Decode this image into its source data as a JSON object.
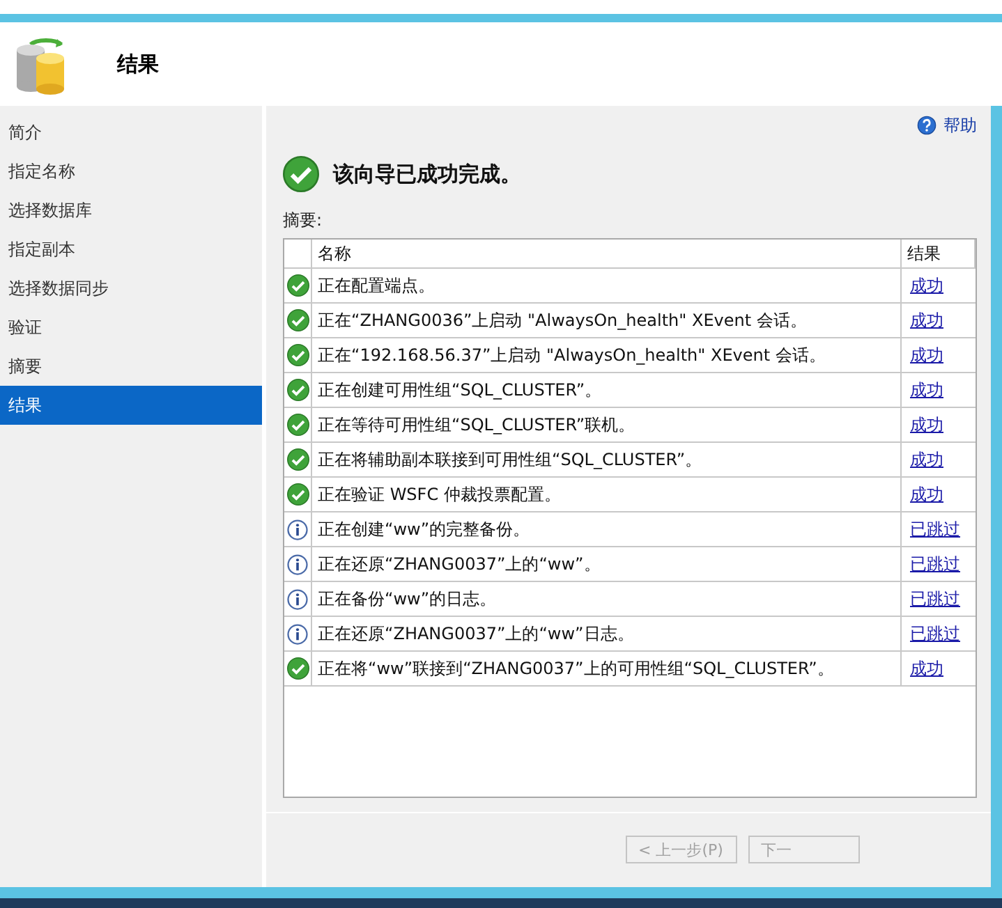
{
  "header": {
    "title": "结果"
  },
  "sidebar": {
    "items": [
      {
        "label": "简介",
        "selected": false
      },
      {
        "label": "指定名称",
        "selected": false
      },
      {
        "label": "选择数据库",
        "selected": false
      },
      {
        "label": "指定副本",
        "selected": false
      },
      {
        "label": "选择数据同步",
        "selected": false
      },
      {
        "label": "验证",
        "selected": false
      },
      {
        "label": "摘要",
        "selected": false
      },
      {
        "label": "结果",
        "selected": true
      }
    ]
  },
  "help_link": "帮助",
  "status_message": "该向导已成功完成。",
  "summary_label": "摘要:",
  "table": {
    "columns": [
      "名称",
      "结果"
    ],
    "rows": [
      {
        "kind": "success",
        "name": "正在配置端点。",
        "result": "成功"
      },
      {
        "kind": "success",
        "name": "正在“ZHANG0036”上启动 \"AlwaysOn_health\" XEvent 会话。",
        "result": "成功"
      },
      {
        "kind": "success",
        "name": "正在“192.168.56.37”上启动 \"AlwaysOn_health\" XEvent 会话。",
        "result": "成功"
      },
      {
        "kind": "success",
        "name": "正在创建可用性组“SQL_CLUSTER”。",
        "result": "成功"
      },
      {
        "kind": "success",
        "name": "正在等待可用性组“SQL_CLUSTER”联机。",
        "result": "成功"
      },
      {
        "kind": "success",
        "name": "正在将辅助副本联接到可用性组“SQL_CLUSTER”。",
        "result": "成功"
      },
      {
        "kind": "success",
        "name": "正在验证 WSFC 仲裁投票配置。",
        "result": "成功"
      },
      {
        "kind": "info",
        "name": "正在创建“ww”的完整备份。",
        "result": "已跳过"
      },
      {
        "kind": "info",
        "name": "正在还原“ZHANG0037”上的“ww”。",
        "result": "已跳过"
      },
      {
        "kind": "info",
        "name": "正在备份“ww”的日志。",
        "result": "已跳过"
      },
      {
        "kind": "info",
        "name": "正在还原“ZHANG0037”上的“ww”日志。",
        "result": "已跳过"
      },
      {
        "kind": "success",
        "name": "正在将“ww”联接到“ZHANG0037”上的可用性组“SQL_CLUSTER”。",
        "result": "成功"
      }
    ]
  },
  "buttons": [
    {
      "label": "< 上一步(P)",
      "disabled": true
    },
    {
      "label": "下一",
      "disabled": true
    }
  ]
}
